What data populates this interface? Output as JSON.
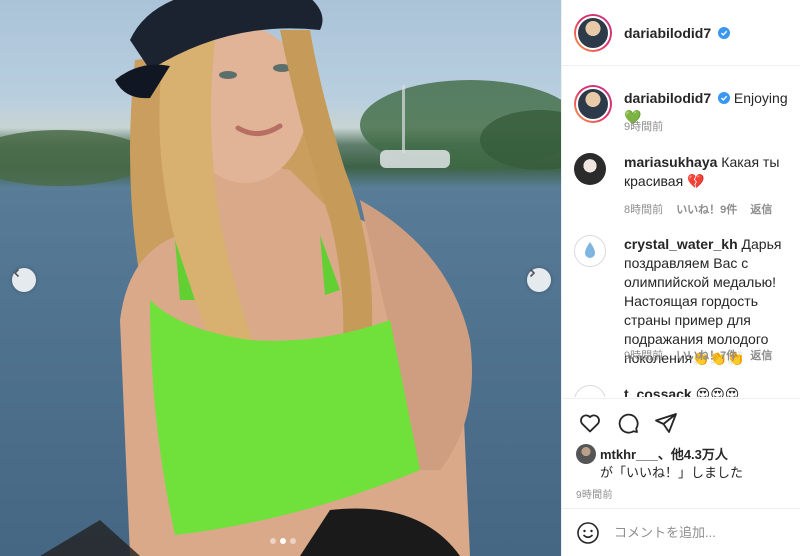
{
  "post": {
    "username": "dariabilodid7",
    "caption": "Enjoying💚",
    "caption_time": "9時間前",
    "likes_user": "mtkhr___",
    "likes_text": "、他4.3万人",
    "likes_suffix": "が「いいね！」しました",
    "post_time": "9時間前"
  },
  "comments": [
    {
      "username": "mariasukhaya",
      "text": "Какая ты красивая 💔",
      "time": "8時間前",
      "likes": "いいね！9件",
      "reply": "返信"
    },
    {
      "username": "crystal_water_kh",
      "text": "Дарья поздравляем Вас с олимпийской медалью! Настоящая гордость страны пример для подражания молодого поколения👏👏👏",
      "time": "9時間前",
      "likes": "いいね！7件",
      "reply": "返信"
    },
    {
      "username": "t_cossack",
      "text": "😍😍😍"
    }
  ],
  "comment_input": {
    "placeholder": "コメントを追加..."
  },
  "carousel": {
    "count": 3,
    "active": 2
  },
  "icons": [
    "heart-icon",
    "comment-icon",
    "share-icon",
    "smile-icon",
    "chevron-left-icon",
    "chevron-right-icon",
    "verified-icon"
  ],
  "colors": {
    "verified": "#3897f0",
    "muted": "#8e8e8e",
    "border": "#efefef"
  }
}
